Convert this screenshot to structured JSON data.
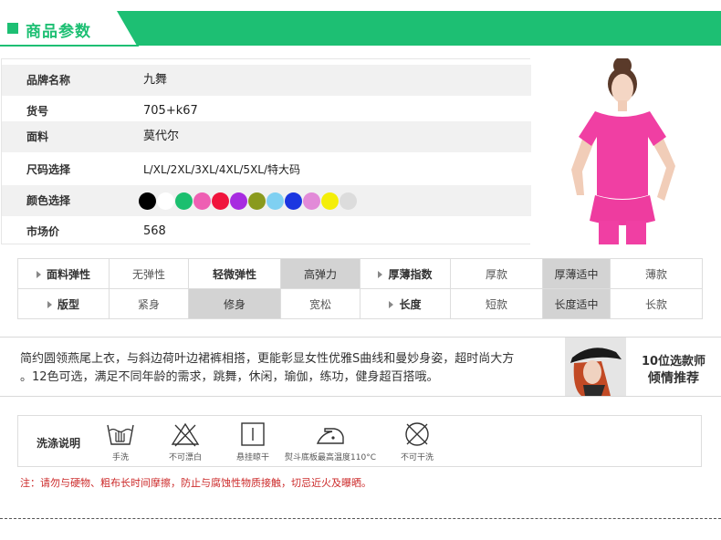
{
  "header": {
    "title": "商品参数"
  },
  "params": [
    {
      "label": "品牌名称",
      "value": "九舞"
    },
    {
      "label": "货号",
      "value": "705+k67"
    },
    {
      "label": "面料",
      "value": "莫代尔"
    },
    {
      "label": "尺码选择",
      "value": "L/XL/2XL/3XL/4XL/5XL/特大码"
    },
    {
      "label": "颜色选择",
      "value": ""
    },
    {
      "label": "市场价",
      "value": "568"
    }
  ],
  "colors": [
    "#000000",
    "#ffffff",
    "#1bbf6f",
    "#ee5fb3",
    "#f0143c",
    "#a72be0",
    "#8a9a1e",
    "#7fd0f2",
    "#1b36e0",
    "#e28ad8",
    "#f4ee08",
    "#dcdcdc"
  ],
  "attributes": {
    "row1_key1": "面料弹性",
    "row1_opts1": [
      "无弹性",
      "轻微弹性",
      "高弹力"
    ],
    "row1_key2": "厚薄指数",
    "row1_opts2": [
      "厚款",
      "厚薄适中",
      "薄款"
    ],
    "row2_key1": "版型",
    "row2_opts1": [
      "紧身",
      "修身",
      "宽松"
    ],
    "row2_key2": "长度",
    "row2_opts2": [
      "短款",
      "长度适中",
      "长款"
    ]
  },
  "description": {
    "line1": "简约圆领燕尾上衣，与斜边荷叶边裙裤相搭，更能彰显女性优雅S曲线和曼妙身姿，超时尚大方",
    "line2": "。12色可选，满足不同年龄的需求，跳舞，休闲，瑜伽，练功，健身超百搭哦。"
  },
  "stylist": {
    "count_label": "10位选款师",
    "tag": "倾情推荐"
  },
  "wash": {
    "title": "洗涤说明",
    "items": [
      {
        "icon": "hand-wash-icon",
        "label": "手洗"
      },
      {
        "icon": "no-bleach-icon",
        "label": "不可漂白"
      },
      {
        "icon": "hang-dry-icon",
        "label": "悬挂晾干"
      },
      {
        "icon": "iron-icon",
        "label": "熨斗底板最高温度110°C"
      },
      {
        "icon": "no-dry-clean-icon",
        "label": "不可干洗"
      }
    ]
  },
  "note": "注：请勿与硬物、粗布长时间摩擦，防止与腐蚀性物质接触，切忌近火及曝晒。"
}
